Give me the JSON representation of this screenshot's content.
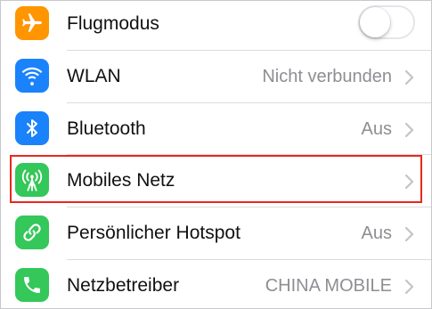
{
  "colors": {
    "airplane_icon_bg": "#ff9500",
    "wifi_icon_bg": "#1a82fb",
    "bluetooth_icon_bg": "#1a82fb",
    "cellular_icon_bg": "#34c759",
    "hotspot_icon_bg": "#34c759",
    "carrier_icon_bg": "#34c759",
    "highlight_border": "#e8281e"
  },
  "settings": {
    "rows": [
      {
        "label": "Flugmodus",
        "icon": "airplane-icon",
        "toggle_on": false
      },
      {
        "label": "WLAN",
        "value": "Nicht verbunden",
        "icon": "wifi-icon"
      },
      {
        "label": "Bluetooth",
        "value": "Aus",
        "icon": "bluetooth-icon"
      },
      {
        "label": "Mobiles Netz",
        "value": "",
        "icon": "cellular-antenna-icon",
        "highlighted": true
      },
      {
        "label": "Persönlicher Hotspot",
        "value": "Aus",
        "icon": "hotspot-chain-icon"
      },
      {
        "label": "Netzbetreiber",
        "value": "CHINA MOBILE",
        "icon": "phone-icon"
      }
    ]
  }
}
